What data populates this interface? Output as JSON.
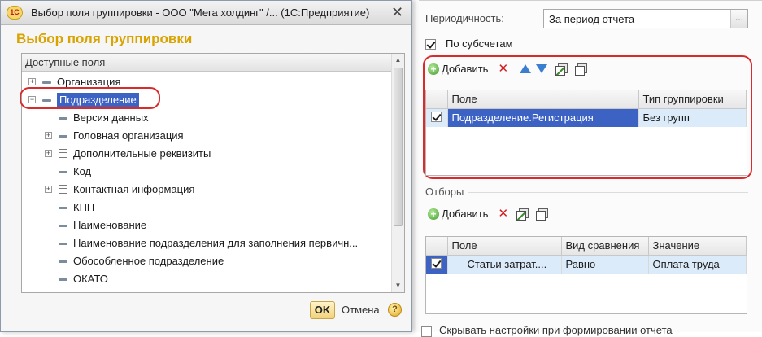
{
  "window": {
    "title": "Выбор поля группировки - ООО \"Мега холдинг\" /... (1С:Предприятие)",
    "logo": "1С",
    "close_glyph": "✕"
  },
  "dialog": {
    "heading": "Выбор поля группировки",
    "tree_header": "Доступные поля",
    "tree_items": [
      {
        "label": "Организация",
        "expander": "⊕",
        "icon": "attribute-icon",
        "level": 0
      },
      {
        "label": "Подразделение",
        "expander": "⊖",
        "icon": "attribute-icon",
        "level": 0,
        "selected": true
      },
      {
        "label": "Версия данных",
        "expander": "",
        "icon": "attribute-icon",
        "level": 1
      },
      {
        "label": "Головная организация",
        "expander": "⊕",
        "icon": "attribute-icon",
        "level": 1
      },
      {
        "label": "Дополнительные реквизиты",
        "expander": "⊕",
        "icon": "table-icon",
        "level": 1
      },
      {
        "label": "Код",
        "expander": "",
        "icon": "attribute-icon",
        "level": 1
      },
      {
        "label": "Контактная информация",
        "expander": "⊕",
        "icon": "table-icon",
        "level": 1
      },
      {
        "label": "КПП",
        "expander": "",
        "icon": "attribute-icon",
        "level": 1
      },
      {
        "label": "Наименование",
        "expander": "",
        "icon": "attribute-icon",
        "level": 1
      },
      {
        "label": "Наименование подразделения для заполнения первичн...",
        "expander": "",
        "icon": "attribute-icon",
        "level": 1
      },
      {
        "label": "Обособленное подразделение",
        "expander": "",
        "icon": "attribute-icon",
        "level": 1
      },
      {
        "label": "ОКАТО",
        "expander": "",
        "icon": "attribute-icon",
        "level": 1
      }
    ],
    "ok_label": "OK",
    "cancel_label": "Отмена",
    "help_glyph": "?"
  },
  "settings": {
    "period_label": "Периодичность:",
    "period_value": "За период отчета",
    "period_button": "...",
    "subaccounts_label": "По субсчетам",
    "subaccounts_checked": true,
    "groups_toolbar": {
      "add_label": "Добавить"
    },
    "groups_grid": {
      "columns": [
        "Поле",
        "Тип группировки"
      ],
      "rows": [
        {
          "checked": true,
          "field": "Подразделение.Регистрация",
          "type": "Без групп"
        }
      ]
    },
    "filters_title": "Отборы",
    "filters_toolbar": {
      "add_label": "Добавить"
    },
    "filters_grid": {
      "columns": [
        "Поле",
        "Вид сравнения",
        "Значение"
      ],
      "rows": [
        {
          "checked": true,
          "field": "Статьи затрат....",
          "comparison": "Равно",
          "value": "Оплата труда"
        }
      ]
    },
    "bottom_checkbox_label": "Скрывать настройки при формировании отчета"
  },
  "colors": {
    "accent_heading": "#d9a300",
    "selection": "#3c62c4",
    "highlight_outline": "#d92b2b"
  }
}
